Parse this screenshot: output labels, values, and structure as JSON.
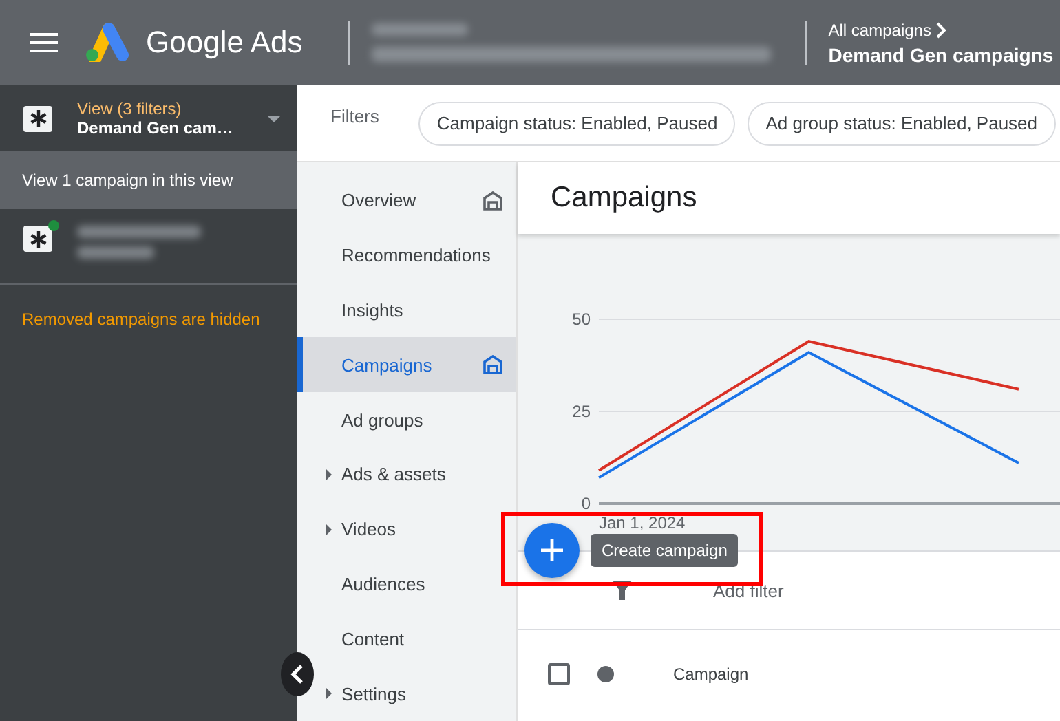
{
  "header": {
    "brand": "Google Ads",
    "breadcrumb": {
      "parent": "All campaigns",
      "current": "Demand Gen campaigns"
    }
  },
  "view_panel": {
    "label": "View (3 filters)",
    "name": "Demand Gen cam…",
    "banner": "View 1 campaign in this view",
    "campaigns": [
      {
        "color": "#1e8e3e"
      }
    ],
    "notice": "Removed campaigns are hidden"
  },
  "filters": {
    "label": "Filters",
    "chips": [
      "Campaign status: Enabled, Paused",
      "Ad group status: Enabled, Paused"
    ]
  },
  "nav": [
    {
      "label": "Overview",
      "selected": false,
      "expandable": false,
      "home": true
    },
    {
      "label": "Recommendations",
      "selected": false,
      "expandable": false,
      "home": false
    },
    {
      "label": "Insights",
      "selected": false,
      "expandable": false,
      "home": false
    },
    {
      "label": "Campaigns",
      "selected": true,
      "expandable": false,
      "home": true
    },
    {
      "label": "Ad groups",
      "selected": false,
      "expandable": false,
      "home": false
    },
    {
      "label": "Ads & assets",
      "selected": false,
      "expandable": true,
      "home": false
    },
    {
      "label": "Videos",
      "selected": false,
      "expandable": true,
      "home": false
    },
    {
      "label": "Audiences",
      "selected": false,
      "expandable": false,
      "home": false
    },
    {
      "label": "Content",
      "selected": false,
      "expandable": false,
      "home": false
    },
    {
      "label": "Settings",
      "selected": false,
      "expandable": true,
      "home": false
    }
  ],
  "page_title": "Campaigns",
  "chart_data": {
    "type": "line",
    "ylim": [
      0,
      50
    ],
    "yticks": [
      {
        "value": 0,
        "label": "0"
      },
      {
        "value": 25,
        "label": "25"
      },
      {
        "value": 50,
        "label": "50"
      }
    ],
    "annotations": [
      "Jan 1, 2024"
    ],
    "series": [
      {
        "color": "#d93025",
        "values": [
          9,
          44,
          31
        ]
      },
      {
        "color": "#1a73e8",
        "values": [
          7,
          41,
          11
        ]
      }
    ]
  },
  "fab": {
    "tooltip": "Create campaign"
  },
  "add_filter": "Add filter",
  "table": {
    "select_all_checked": false,
    "columns": [
      "Campaign"
    ]
  }
}
